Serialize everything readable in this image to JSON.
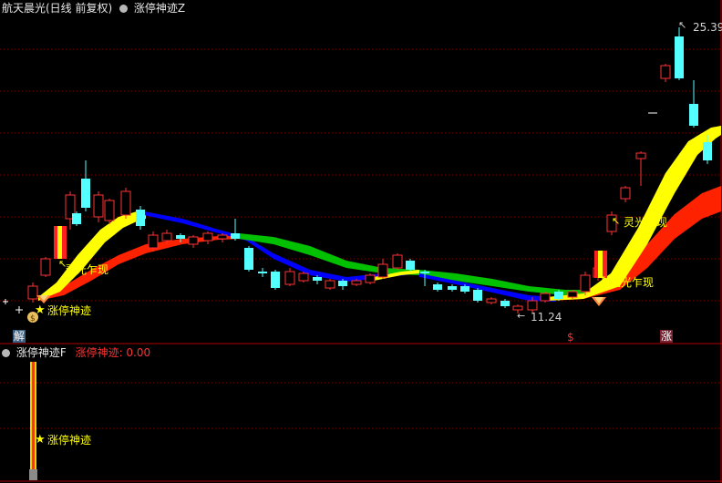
{
  "main_panel": {
    "title": "航天晨光(日线 前复权)",
    "indicator": "涨停神迹Z"
  },
  "sub_panel": {
    "indicator": "涨停神迹F",
    "readout": "涨停神迹: 0.00"
  },
  "annotations": {
    "signal_label": "涨停神迹",
    "pattern_label": "灵光乍现",
    "high_price": "25.39",
    "low_price": "11.24"
  },
  "badges": {
    "jie": "解",
    "dollar": "$",
    "zhang": "涨"
  },
  "colors": {
    "background": "#000000",
    "grid": "#800000",
    "up_candle": "#ff3232",
    "down_candle": "#54ffff",
    "line_yellow": "#ffff00",
    "line_red": "#ff2200",
    "line_blue": "#0000ff",
    "line_green": "#00c000",
    "label_yellow": "#ffff00"
  },
  "chart_data": {
    "type": "candlestick",
    "price_high": 25.39,
    "price_low": 11.24,
    "sub_value": 0.0
  }
}
